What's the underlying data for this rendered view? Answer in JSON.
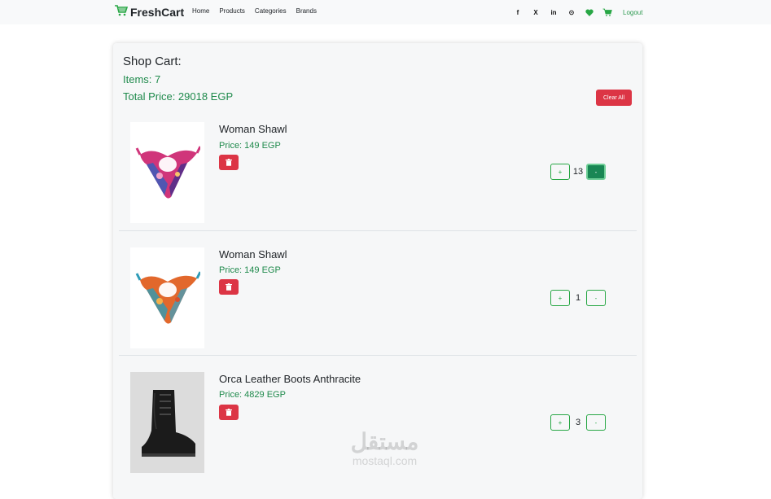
{
  "navbar": {
    "brand": "FreshCart",
    "links": [
      "Home",
      "Products",
      "Categories",
      "Brands"
    ],
    "social_icons": [
      "facebook-icon",
      "x-twitter-icon",
      "linkedin-icon",
      "github-icon"
    ],
    "social_glyphs": [
      "f",
      "X",
      "in",
      "⊙"
    ],
    "logout": "Logout"
  },
  "cart": {
    "title": "Shop Cart:",
    "items_count": "Items: 7",
    "total_price": "Total Price: 29018 EGP",
    "clear_label": "Clear All",
    "items": [
      {
        "name": "Woman Shawl",
        "price": "Price: 149 EGP",
        "quantity": "13",
        "plus": "+",
        "minus": "-",
        "image": "scarf-image-pink"
      },
      {
        "name": "Woman Shawl",
        "price": "Price: 149 EGP",
        "quantity": "1",
        "plus": "+",
        "minus": "-",
        "image": "scarf-image-orange"
      },
      {
        "name": "Orca Leather Boots Anthracite",
        "price": "Price: 4829 EGP",
        "quantity": "3",
        "plus": "+",
        "minus": "-",
        "image": "boot-image"
      }
    ]
  },
  "watermark": {
    "arabic": "مستقل",
    "latin": "mostaql.com"
  },
  "colors": {
    "accent": "#1f8a4c",
    "danger": "#dc3545",
    "brand_icon": "#28a745"
  }
}
